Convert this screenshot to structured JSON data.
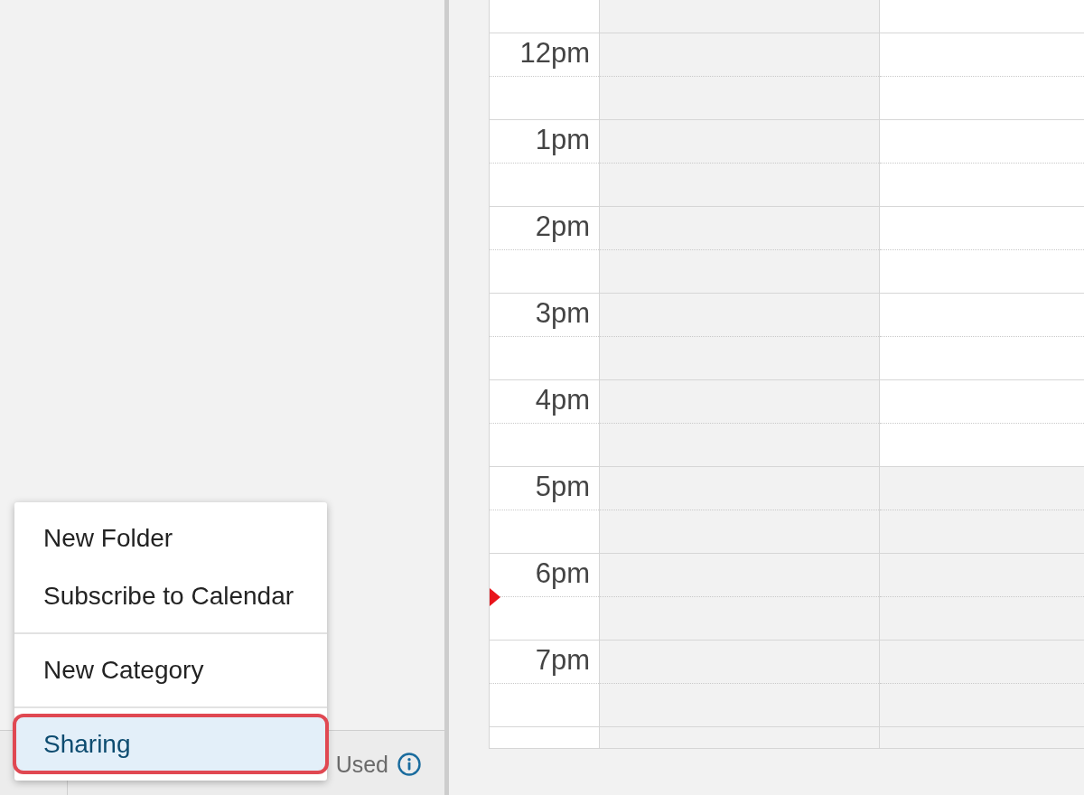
{
  "sidebar": {
    "storage_bar": {
      "label": "Used"
    }
  },
  "calendar": {
    "rows": [
      {
        "current_time": false,
        "cells": [
          {
            "working": false
          },
          {
            "working": true
          }
        ]
      },
      {
        "time": "12pm",
        "current_time": false,
        "cells": [
          {
            "working": false
          },
          {
            "working": true
          }
        ]
      },
      {
        "time": "1pm",
        "current_time": false,
        "cells": [
          {
            "working": false
          },
          {
            "working": true
          }
        ]
      },
      {
        "time": "2pm",
        "current_time": false,
        "cells": [
          {
            "working": false
          },
          {
            "working": true
          }
        ]
      },
      {
        "time": "3pm",
        "current_time": false,
        "cells": [
          {
            "working": false
          },
          {
            "working": true
          }
        ]
      },
      {
        "time": "4pm",
        "current_time": false,
        "cells": [
          {
            "working": false
          },
          {
            "working": true
          }
        ]
      },
      {
        "time": "5pm",
        "current_time": false,
        "cells": [
          {
            "working": false
          },
          {
            "working": false
          }
        ]
      },
      {
        "time": "6pm",
        "current_time": true,
        "cells": [
          {
            "working": false
          },
          {
            "working": false
          }
        ]
      },
      {
        "time": "7pm",
        "current_time": false,
        "cells": [
          {
            "working": false
          },
          {
            "working": false
          }
        ]
      },
      {
        "current_time": false,
        "cells": [
          {
            "working": false
          },
          {
            "working": false
          }
        ]
      }
    ]
  },
  "context_menu": {
    "groups": [
      {
        "items": [
          {
            "label": "New Folder",
            "selected": false,
            "highlighted": false
          },
          {
            "label": "Subscribe to Calendar",
            "selected": false,
            "highlighted": false
          }
        ]
      },
      {
        "items": [
          {
            "label": "New Category",
            "selected": false,
            "highlighted": false
          }
        ]
      },
      {
        "items": [
          {
            "label": "Sharing",
            "selected": true,
            "highlighted": true
          }
        ]
      }
    ]
  }
}
